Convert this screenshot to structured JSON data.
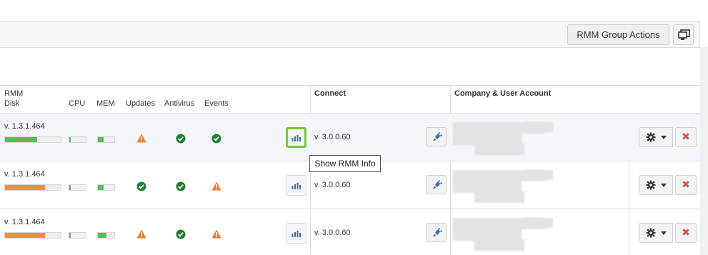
{
  "toolbar": {
    "group_actions_label": "RMM Group Actions",
    "monitor_icon": "remote-monitor-icon"
  },
  "columns": {
    "rmm": "RMM",
    "disk": "Disk",
    "cpu": "CPU",
    "mem": "MEM",
    "updates": "Updates",
    "antivirus": "Antivirus",
    "events": "Events",
    "connect": "Connect",
    "company_user": "Company & User Account"
  },
  "rows": [
    {
      "rmm_version": "v. 1.3.1.464",
      "disk_fill": 0.58,
      "disk_color": "#5cb85c",
      "cpu_fill": 0.08,
      "mem_fill": 0.36,
      "updates": "warning",
      "antivirus": "ok",
      "events": "ok",
      "connect_version": "v. 3.0.0.60",
      "highlighted": true
    },
    {
      "rmm_version": "v. 1.3.1.464",
      "disk_fill": 0.72,
      "disk_color": "#f7902c",
      "cpu_fill": 0.08,
      "mem_fill": 0.36,
      "updates": "ok",
      "antivirus": "ok",
      "events": "warning",
      "connect_version": "v. 3.0.0.60",
      "highlighted": false
    },
    {
      "rmm_version": "v. 1.3.1.464",
      "disk_fill": 0.72,
      "disk_color": "#f7902c",
      "cpu_fill": 0.08,
      "mem_fill": 0.5,
      "updates": "warning",
      "antivirus": "ok",
      "events": "warning",
      "connect_version": "v. 3.0.0.60",
      "highlighted": false
    }
  ],
  "tooltip": "Show RMM Info",
  "colors": {
    "ok": "#1e7e34",
    "warning": "#f0782a",
    "active_border": "#7ac143",
    "delete": "#d9534f",
    "connect_icon": "#3a6ea5"
  }
}
